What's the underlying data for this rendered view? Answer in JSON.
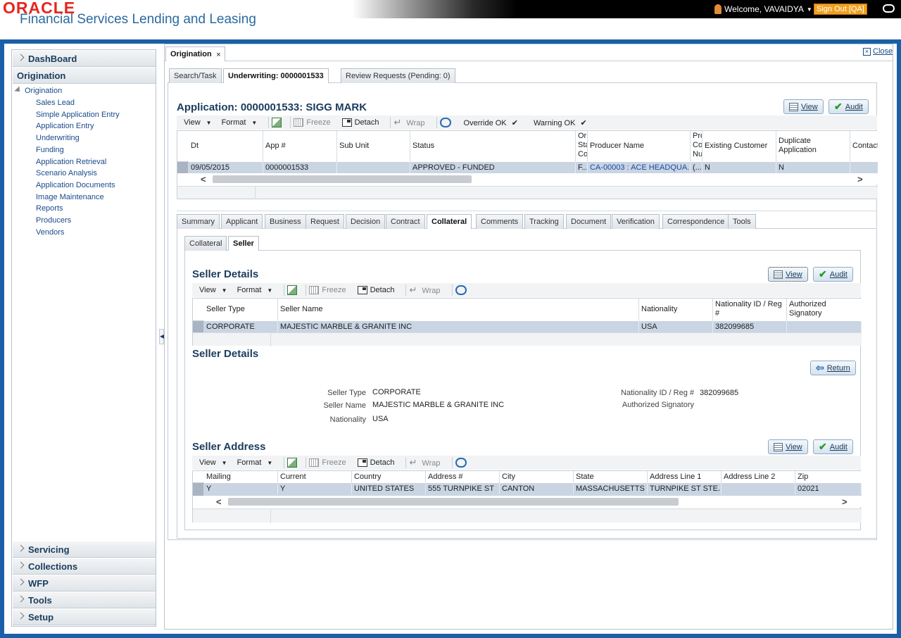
{
  "header": {
    "logo": "ORACLE",
    "product": "Financial Services Lending and Leasing",
    "welcome": "Welcome, VAVAIDYA",
    "signout": "Sign Out [QA]"
  },
  "sidebar": {
    "dashboard": "DashBoard",
    "origination": "Origination",
    "tree_root": "Origination",
    "items": [
      "Sales Lead",
      "Simple Application Entry",
      "Application Entry",
      "Underwriting",
      "Funding",
      "Application Retrieval",
      "Scenario Analysis",
      "Application Documents",
      "Image Maintenance",
      "Reports",
      "Producers",
      "Vendors"
    ],
    "bottom": [
      "Servicing",
      "Collections",
      "WFP",
      "Tools",
      "Setup"
    ]
  },
  "main": {
    "top_tab": "Origination",
    "close": "Close",
    "sub_tabs": [
      "Search/Task",
      "Underwriting: 0000001533",
      "Review Requests (Pending: 0)"
    ],
    "app_title": "Application: 0000001533: SIGG MARK",
    "view": "View",
    "audit": "Audit",
    "return": "Return",
    "toolbar": {
      "view": "View",
      "format": "Format",
      "freeze": "Freeze",
      "detach": "Detach",
      "wrap": "Wrap",
      "override": "Override OK",
      "warning": "Warning OK"
    },
    "app_grid": {
      "headers": [
        "Dt",
        "App #",
        "Sub Unit",
        "Status",
        "Ori Sta Coo",
        "Producer Name",
        "Pro Co Nu",
        "Existing Customer",
        "Duplicate Application",
        "Contact"
      ],
      "row": [
        "09/05/2015",
        "0000001533",
        "",
        "APPROVED - FUNDED",
        "F...",
        "CA-00003 : ACE HEADQUA...",
        "(...",
        "N",
        "N",
        ""
      ]
    },
    "section_tabs": [
      "Summary",
      "Applicant",
      "Business",
      "Request",
      "Decision",
      "Contract",
      "Collateral",
      "Comments",
      "Tracking",
      "Document",
      "Verification",
      "Correspondence",
      "Tools"
    ],
    "inner_tabs": [
      "Collateral",
      "Seller"
    ],
    "seller_grid_title": "Seller Details",
    "seller_grid": {
      "headers": [
        "Seller Type",
        "Seller Name",
        "Nationality",
        "Nationality ID / Reg #",
        "Authorized Signatory"
      ],
      "row": [
        "CORPORATE",
        "MAJESTIC MARBLE & GRANITE INC",
        "USA",
        "382099685",
        ""
      ]
    },
    "seller_detail_title": "Seller Details",
    "seller_detail": {
      "type_label": "Seller Type",
      "type": "CORPORATE",
      "name_label": "Seller Name",
      "name": "MAJESTIC MARBLE & GRANITE INC",
      "nat_label": "Nationality",
      "nat": "USA",
      "natid_label": "Nationality ID / Reg #",
      "natid": "382099685",
      "auth_label": "Authorized Signatory",
      "auth": ""
    },
    "address_title": "Seller Address",
    "address_grid": {
      "headers": [
        "Mailing",
        "Current",
        "Country",
        "Address #",
        "City",
        "State",
        "Address Line 1",
        "Address Line 2",
        "Zip"
      ],
      "row": [
        "Y",
        "Y",
        "UNITED STATES",
        "555 TURNPIKE ST",
        "CANTON",
        "MASSACHUSETTS",
        "TURNPIKE ST STE...",
        "",
        "02021"
      ]
    }
  },
  "colors": {
    "brand_red": "#e5261e",
    "frame_blue": "#1b5fa8",
    "row_selected": "#c9d5e3",
    "signout_orange": "#f0a020"
  }
}
